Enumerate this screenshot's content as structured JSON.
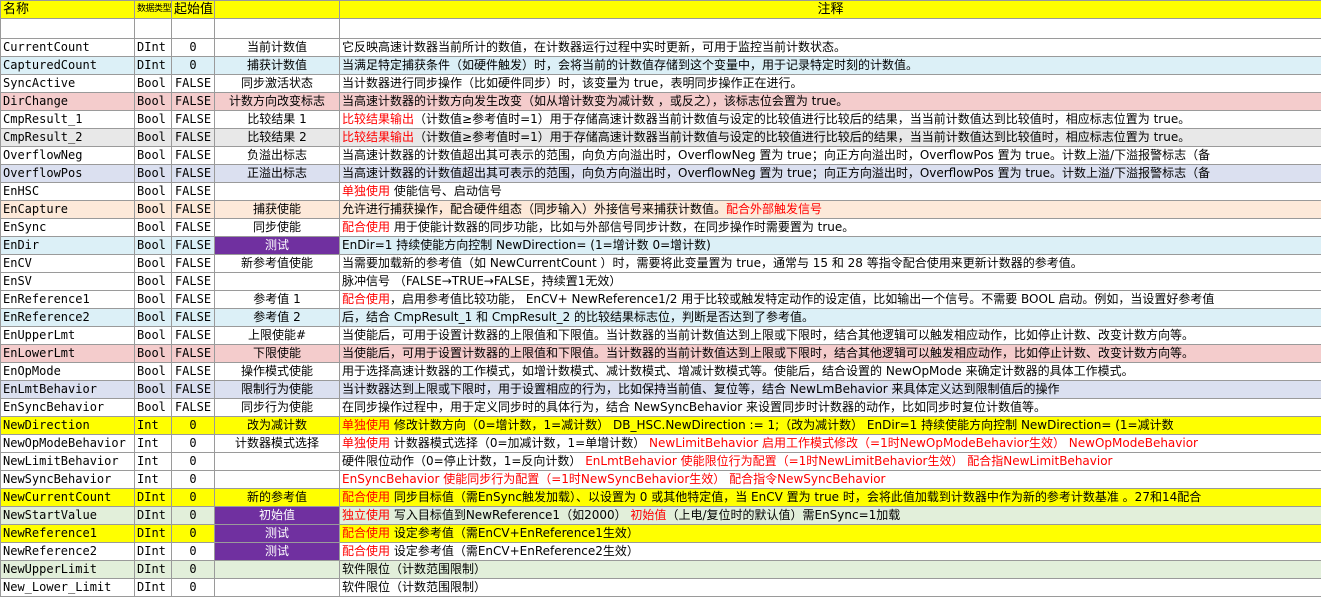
{
  "header": {
    "name": "名称",
    "type": "数据类型",
    "init": "起始值",
    "desc": "",
    "note": "注释"
  },
  "rows": [
    {
      "name": "CurrentCount",
      "type": "DInt",
      "init": "0",
      "desc": "当前计数值",
      "note": [
        {
          "t": "它反映高速计数器当前所计的数值，在计数器运行过程中实时更新，可用于监控当前计数状态。"
        }
      ]
    },
    {
      "name": "CapturedCount",
      "type": "DInt",
      "init": "0",
      "desc": "捕获计数值",
      "note": [
        {
          "t": "当满足特定捕获条件（如硬件触发）时，会将当前的计数值存储到这个变量中，用于记录特定时刻的计数值。"
        }
      ]
    },
    {
      "name": "SyncActive",
      "type": "Bool",
      "init": "FALSE",
      "desc": "同步激活状态",
      "note": [
        {
          "t": "当计数器进行同步操作（比如硬件同步）时，该变量为 true，表明同步操作正在进行。"
        }
      ]
    },
    {
      "name": "DirChange",
      "type": "Bool",
      "init": "FALSE",
      "desc": "计数方向改变标志",
      "note": [
        {
          "t": "当高速计数器的计数方向发生改变（如从增计数变为减计数 ，或反之），该标志位会置为 true。"
        }
      ]
    },
    {
      "name": "CmpResult_1",
      "type": "Bool",
      "init": "FALSE",
      "desc": "比较结果 1",
      "note": [
        {
          "t": "比较结果输出",
          "red": true
        },
        {
          "t": "（计数值≥参考值时=1）用于存储高速计数器当前计数值与设定的比较值进行比较后的结果，当当前计数值达到比较值时，相应标志位置为 true。"
        }
      ]
    },
    {
      "name": "CmpResult_2",
      "type": "Bool",
      "init": "FALSE",
      "desc": "比较结果 2",
      "note": [
        {
          "t": "比较结果输出",
          "red": true
        },
        {
          "t": "（计数值≥参考值时=1）用于存储高速计数器当前计数值与设定的比较值进行比较后的结果，当当前计数值达到比较值时，相应标志位置为 true。"
        }
      ]
    },
    {
      "name": "OverflowNeg",
      "type": "Bool",
      "init": "FALSE",
      "desc": "负溢出标志",
      "note": [
        {
          "t": "当高速计数器的计数值超出其可表示的范围，向负方向溢出时，OverflowNeg 置为 true；向正方向溢出时，OverflowPos 置为 true。计数上溢/下溢报警标志（备"
        }
      ]
    },
    {
      "name": "OverflowPos",
      "type": "Bool",
      "init": "FALSE",
      "desc": "正溢出标志",
      "note": [
        {
          "t": "当高速计数器的计数值超出其可表示的范围，向负方向溢出时，OverflowNeg 置为 true；向正方向溢出时，OverflowPos 置为 true。计数上溢/下溢报警标志（备"
        }
      ]
    },
    {
      "name": "EnHSC",
      "type": "Bool",
      "init": "FALSE",
      "desc": "",
      "note": [
        {
          "t": "单独使用",
          "red": true
        },
        {
          "t": "  使能信号、启动信号"
        }
      ]
    },
    {
      "name": "EnCapture",
      "type": "Bool",
      "init": "FALSE",
      "desc": "捕获使能",
      "note": [
        {
          "t": "允许进行捕获操作，配合硬件组态（同步输入）外接信号来捕获计数值。"
        },
        {
          "t": "配合外部触发信号",
          "red": true
        }
      ]
    },
    {
      "name": "EnSync",
      "type": "Bool",
      "init": "FALSE",
      "desc": "同步使能",
      "note": [
        {
          "t": "配合使用",
          "red": true
        },
        {
          "t": " 用于使能计数器的同步功能，比如与外部信号同步计数，在同步操作时需要置为 true。"
        }
      ]
    },
    {
      "name": "EnDir",
      "type": "Bool",
      "init": "FALSE",
      "desc": "测试",
      "note": [
        {
          "t": "EnDir=1 持续使能方向控制   NewDirection= (1=增计数  0=增计数)"
        }
      ]
    },
    {
      "name": "EnCV",
      "type": "Bool",
      "init": "FALSE",
      "desc": "新参考值使能",
      "note": [
        {
          "t": "当需要加载新的参考值（如 NewCurrentCount ）时，需要将此变量置为 true，通常与 15 和 28 等指令配合使用来更新计数器的参考值。"
        }
      ]
    },
    {
      "name": "EnSV",
      "type": "Bool",
      "init": "FALSE",
      "desc": "",
      "note": [
        {
          "t": " 脉冲信号 （FALSE→TRUE→FALSE，持续置1无效）"
        }
      ]
    },
    {
      "name": "EnReference1",
      "type": "Bool",
      "init": "FALSE",
      "desc": "参考值 1",
      "note": [
        {
          "t": " "
        },
        {
          "t": "配合使用",
          "red": true
        },
        {
          "t": "，启用参考值比较功能， EnCV+ NewReference1/2 用于比较或触发特定动作的设定值，比如输出一个信号。不需要 BOOL 启动。例如，当设置好参考值"
        }
      ]
    },
    {
      "name": "EnReference2",
      "type": "Bool",
      "init": "FALSE",
      "desc": "参考值 2",
      "note": [
        {
          "t": "                    后，结合 CmpResult_1 和 CmpResult_2 的比较结果标志位，判断是否达到了参考值。"
        }
      ]
    },
    {
      "name": "EnUpperLmt",
      "type": "Bool",
      "init": "FALSE",
      "desc": "上限使能#",
      "note": [
        {
          "t": "当使能后，可用于设置计数器的上限值和下限值。当计数器的当前计数值达到上限或下限时，结合其他逻辑可以触发相应动作，比如停止计数、改变计数方向等。"
        }
      ]
    },
    {
      "name": "EnLowerLmt",
      "type": "Bool",
      "init": "FALSE",
      "desc": "下限使能",
      "note": [
        {
          "t": "当使能后，可用于设置计数器的上限值和下限值。当计数器的当前计数值达到上限或下限时，结合其他逻辑可以触发相应动作，比如停止计数、改变计数方向等。"
        }
      ]
    },
    {
      "name": "EnOpMode",
      "type": "Bool",
      "init": "FALSE",
      "desc": "操作模式使能",
      "note": [
        {
          "t": "用于选择高速计数器的工作模式，如增计数模式、减计数模式、增减计数模式等。使能后，结合设置的 NewOpMode 来确定计数器的具体工作模式。"
        }
      ]
    },
    {
      "name": "EnLmtBehavior",
      "type": "Bool",
      "init": "FALSE",
      "desc": "限制行为使能",
      "note": [
        {
          "t": "当计数器达到上限或下限时，用于设置相应的行为，比如保持当前值、复位等，结合 NewLmBehavior 来具体定义达到限制值后的操作"
        }
      ]
    },
    {
      "name": "EnSyncBehavior",
      "type": "Bool",
      "init": "FALSE",
      "desc": "同步行为使能",
      "note": [
        {
          "t": "在同步操作过程中，用于定义同步时的具体行为，结合 NewSyncBehavior 来设置同步时计数器的动作，比如同步时复位计数值等。"
        }
      ]
    },
    {
      "name": "NewDirection",
      "type": "Int",
      "init": "0",
      "desc": "改为减计数",
      "note": [
        {
          "t": "单独使用",
          "red": true
        },
        {
          "t": " 修改计数方向（0=增计数，1=减计数）    DB_HSC.NewDirection := 1;（改为减计数）     EnDir=1 持续使能方向控制   NewDirection= (1=减计数"
        }
      ]
    },
    {
      "name": "NewOpModeBehavior",
      "type": "Int",
      "init": "0",
      "desc": "计数器模式选择",
      "note": [
        {
          "t": "单独使用",
          "red": true
        },
        {
          "t": " 计数器模式选择（0=加减计数，1=单增计数）    "
        },
        {
          "t": "NewLimitBehavior      启用工作模式修改（=1时NewOpModeBehavior生效） NewOpModeBehavior",
          "red": true
        }
      ]
    },
    {
      "name": "NewLimitBehavior",
      "type": "Int",
      "init": "0",
      "desc": "",
      "note": [
        {
          "t": "硬件限位动作（0=停止计数，1=反向计数）      "
        },
        {
          "t": "EnLmtBehavior   使能限位行为配置（=1时NewLimitBehavior生效） 配合指NewLimitBehavior",
          "red": true
        }
      ]
    },
    {
      "name": "NewSyncBehavior",
      "type": "Int",
      "init": "0",
      "desc": "",
      "note": [
        {
          "t": "EnSyncBehavior    使能同步行为配置（=1时NewSyncBehavior生效）  配合指令NewSyncBehavior",
          "red": true
        }
      ]
    },
    {
      "name": "NewCurrentCount",
      "type": "DInt",
      "init": "0",
      "desc": "新的参考值",
      "note": [
        {
          "t": "配合使用",
          "red": true
        },
        {
          "t": " 同步目标值（需EnSync触发加载）、以设置为 0 或其他特定值，当 EnCV 置为 true 时，会将此值加载到计数器中作为新的参考计数基准 。27和14配合"
        }
      ]
    },
    {
      "name": "NewStartValue",
      "type": "DInt",
      "init": "0",
      "desc": "初始值",
      "note": [
        {
          "t": "独立使用",
          "red": true
        },
        {
          "t": " 写入目标值到NewReference1（如2000）   "
        },
        {
          "t": "初始值",
          "red": true
        },
        {
          "t": "（上电/复位时的默认值）需EnSync=1加载"
        }
      ]
    },
    {
      "name": "NewReference1",
      "type": "DInt",
      "init": "0",
      "desc": "测试",
      "note": [
        {
          "t": "配合使用",
          "red": true
        },
        {
          "t": "  设定参考值（需EnCV+EnReference1生效）"
        }
      ]
    },
    {
      "name": "NewReference2",
      "type": "DInt",
      "init": "0",
      "desc": "测试",
      "note": [
        {
          "t": "配合使用",
          "red": true
        },
        {
          "t": "  设定参考值（需EnCV+EnReference2生效）"
        }
      ]
    },
    {
      "name": "NewUpperLimit",
      "type": "DInt",
      "init": "0",
      "desc": "",
      "note": [
        {
          "t": "软件限位（计数范围限制）"
        }
      ]
    },
    {
      "name": "New_Lower_Limit",
      "type": "DInt",
      "init": "0",
      "desc": "",
      "note": [
        {
          "t": "软件限位（计数范围限制）"
        }
      ]
    }
  ],
  "colors": {
    "header": "#ffff00",
    "purple": "#7030a0",
    "red_text": "#ff0000"
  }
}
